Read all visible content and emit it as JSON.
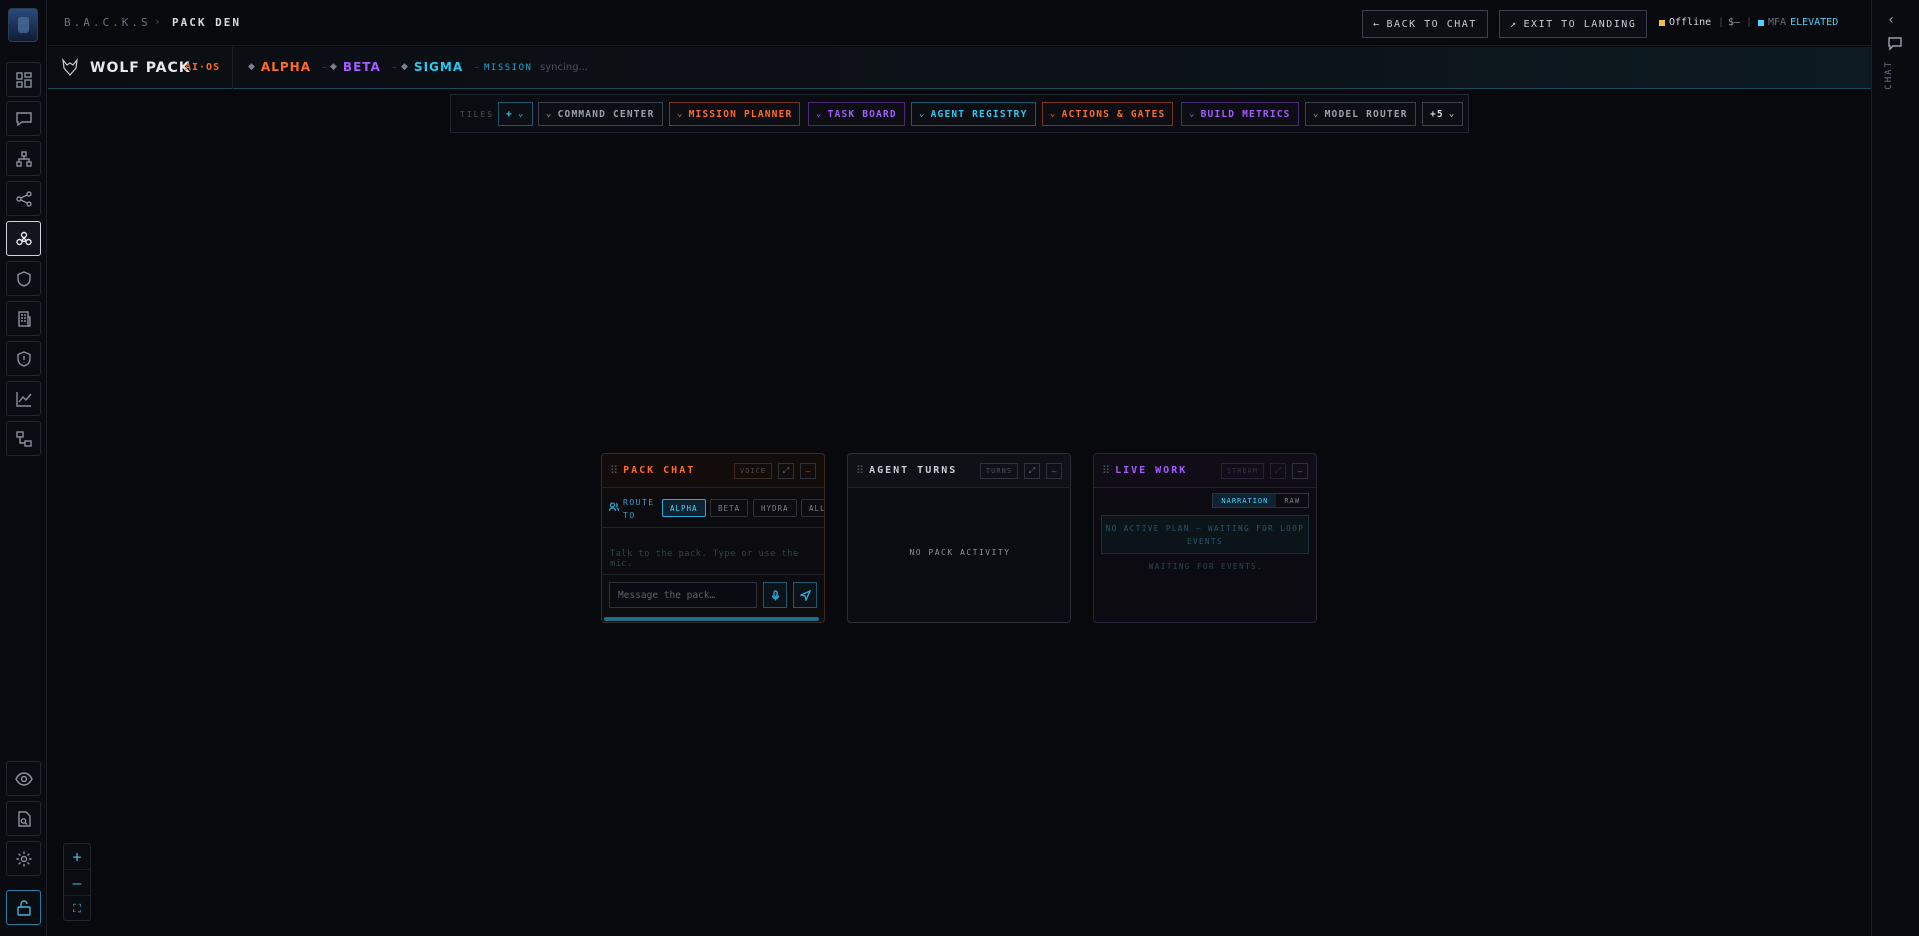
{
  "breadcrumb": {
    "root": "B.A.C.K.S",
    "separator": "›",
    "page": "PACK DEN"
  },
  "header": {
    "back_to_chat": "BACK TO CHAT",
    "back_icon": "←",
    "exit_to_landing": "EXIT TO LANDING",
    "exit_icon": "↗",
    "status_label": "Offline",
    "status_color": "#f0c040",
    "cost": "$—",
    "mfa_label": "MFA",
    "mfa_state": "ELEVATED",
    "mfa_color": "#4fd0ff"
  },
  "right_rail": {
    "collapse_icon": "‹",
    "label": "CHAT"
  },
  "pack": {
    "title": "WOLF PACK",
    "subtitle": "AI·OS",
    "agents": [
      {
        "name": "ALPHA",
        "color": "#ff6a2a",
        "dash": "–"
      },
      {
        "name": "BETA",
        "color": "#a45bff",
        "dash": "–"
      },
      {
        "name": "SIGMA",
        "color": "#2ac8f0",
        "dash": "–"
      }
    ],
    "mission_label": "MISSION",
    "mission_status": "syncing..."
  },
  "tiles": {
    "label": "TILES",
    "add_label": "+",
    "items": [
      {
        "label": "COMMAND CENTER",
        "color": "#9aa0ac",
        "border": "#3a3f4c"
      },
      {
        "label": "MISSION PLANNER",
        "color": "#ff6a2a",
        "border": "#7a3418"
      },
      {
        "label": "TASK BOARD",
        "color": "#a45bff",
        "border": "#4a2a78"
      },
      {
        "label": "AGENT REGISTRY",
        "color": "#2ac8f0",
        "border": "#1a5a70"
      },
      {
        "label": "ACTIONS & GATES",
        "color": "#ff6a2a",
        "border": "#7a3418"
      },
      {
        "label": "BUILD METRICS",
        "color": "#a45bff",
        "border": "#4a2a78"
      },
      {
        "label": "MODEL ROUTER",
        "color": "#9aa0ac",
        "border": "#3a3f4c"
      }
    ],
    "more_label": "+5"
  },
  "pack_chat": {
    "title": "PACK CHAT",
    "title_color": "#ff6a2a",
    "tag": "VOICE",
    "route_label": "ROUTE TO",
    "routes": [
      "ALPHA",
      "BETA",
      "HYDRA",
      "ALL"
    ],
    "hint": "Talk to the pack. Type or use the mic.",
    "input_placeholder": "Message the pack…"
  },
  "agent_turns": {
    "title": "AGENT TURNS",
    "title_color": "#c8ccd6",
    "tag": "TURNS",
    "empty": "NO PACK ACTIVITY"
  },
  "live_work": {
    "title": "LIVE WORK",
    "title_color": "#a45bff",
    "tag": "STREAM",
    "modes": [
      "NARRATION",
      "RAW"
    ],
    "plan": "NO ACTIVE PLAN — WAITING FOR LOOP EVENTS",
    "waiting": "WAITING FOR EVENTS."
  },
  "zoom": {
    "in": "+",
    "out": "—",
    "fit": "⛶"
  }
}
